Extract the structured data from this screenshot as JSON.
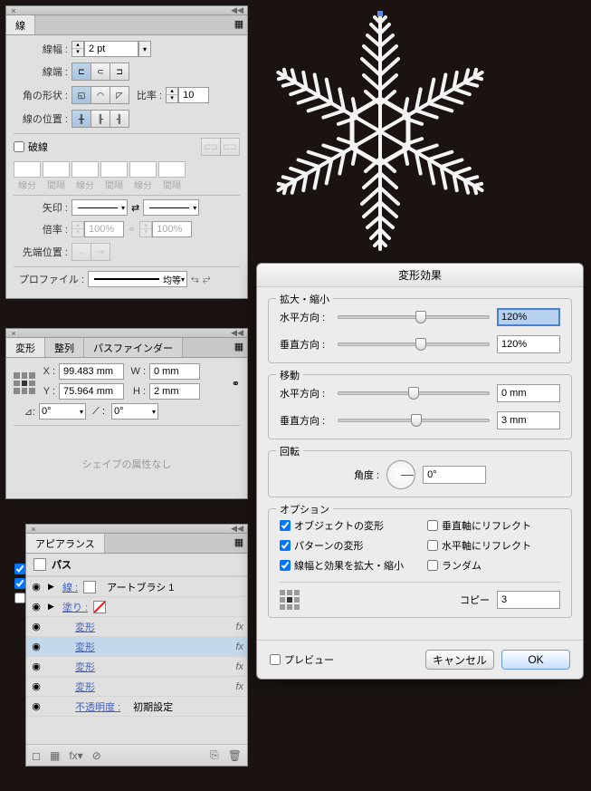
{
  "stroke_panel": {
    "title": "線",
    "weight_label": "線幅 :",
    "weight_value": "2 pt",
    "cap_label": "線端 :",
    "corner_label": "角の形状 :",
    "ratio_label": "比率 :",
    "ratio_value": "10",
    "align_label": "線の位置 :",
    "dashed_label": "破線",
    "dash_cols": [
      "線分",
      "間隔",
      "線分",
      "間隔",
      "線分",
      "間隔"
    ],
    "arrow_label": "矢印 :",
    "scale_label": "倍率 :",
    "scale_a": "100%",
    "scale_b": "100%",
    "tip_label": "先端位置 :",
    "profile_label": "プロファイル :",
    "profile_value": "均等"
  },
  "transform_panel": {
    "tabs": [
      "変形",
      "整列",
      "パスファインダー"
    ],
    "x_label": "X :",
    "y_label": "Y :",
    "w_label": "W :",
    "h_label": "H :",
    "x_value": "99.483 mm",
    "y_value": "75.964 mm",
    "w_value": "0 mm",
    "h_value": "2 mm",
    "angle_label": "⊿:",
    "angle_value": "0°",
    "shear_value": "0°",
    "no_shape": "シェイプの属性なし"
  },
  "appearance_panel": {
    "title": "アピアランス",
    "path": "パス",
    "stroke": "線 :",
    "stroke_val": "アートブラシ 1",
    "fill": "塗り :",
    "effect": "変形",
    "opacity": "不透明度 :",
    "opacity_val": "初期設定",
    "fx": "fx"
  },
  "dialog": {
    "title": "変形効果",
    "scale_section": "拡大・縮小",
    "h_label": "水平方向 :",
    "v_label": "垂直方向 :",
    "scale_h": "120%",
    "scale_v": "120%",
    "move_section": "移動",
    "move_h": "0 mm",
    "move_v": "3 mm",
    "rotate_section": "回転",
    "angle_label": "角度 :",
    "angle_value": "0°",
    "options_section": "オプション",
    "opt_transform_obj": "オブジェクトの変形",
    "opt_reflect_v": "垂直軸にリフレクト",
    "opt_transform_pat": "パターンの変形",
    "opt_reflect_h": "水平軸にリフレクト",
    "opt_scale_stroke": "線幅と効果を拡大・縮小",
    "opt_random": "ランダム",
    "copy_label": "コピー",
    "copy_value": "3",
    "preview": "プレビュー",
    "cancel": "キャンセル",
    "ok": "OK"
  }
}
